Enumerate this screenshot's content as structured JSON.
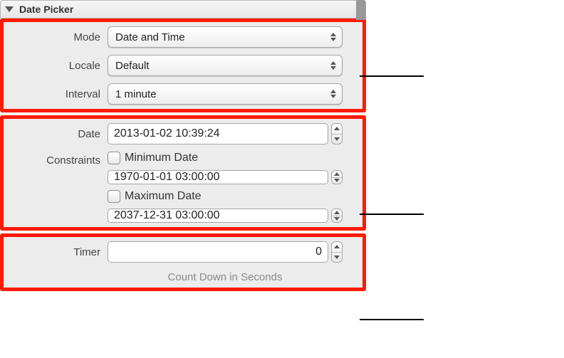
{
  "header": {
    "title": "Date Picker"
  },
  "section1": {
    "mode_label": "Mode",
    "mode_value": "Date and Time",
    "locale_label": "Locale",
    "locale_value": "Default",
    "interval_label": "Interval",
    "interval_value": "1 minute"
  },
  "section2": {
    "date_label": "Date",
    "date_value": "2013-01-02 10:39:24",
    "constraints_label": "Constraints",
    "min_label": "Minimum Date",
    "min_value": "1970-01-01 03:00:00",
    "max_label": "Maximum Date",
    "max_value": "2037-12-31 03:00:00"
  },
  "section3": {
    "timer_label": "Timer",
    "timer_value": "0",
    "hint": "Count Down in Seconds"
  }
}
